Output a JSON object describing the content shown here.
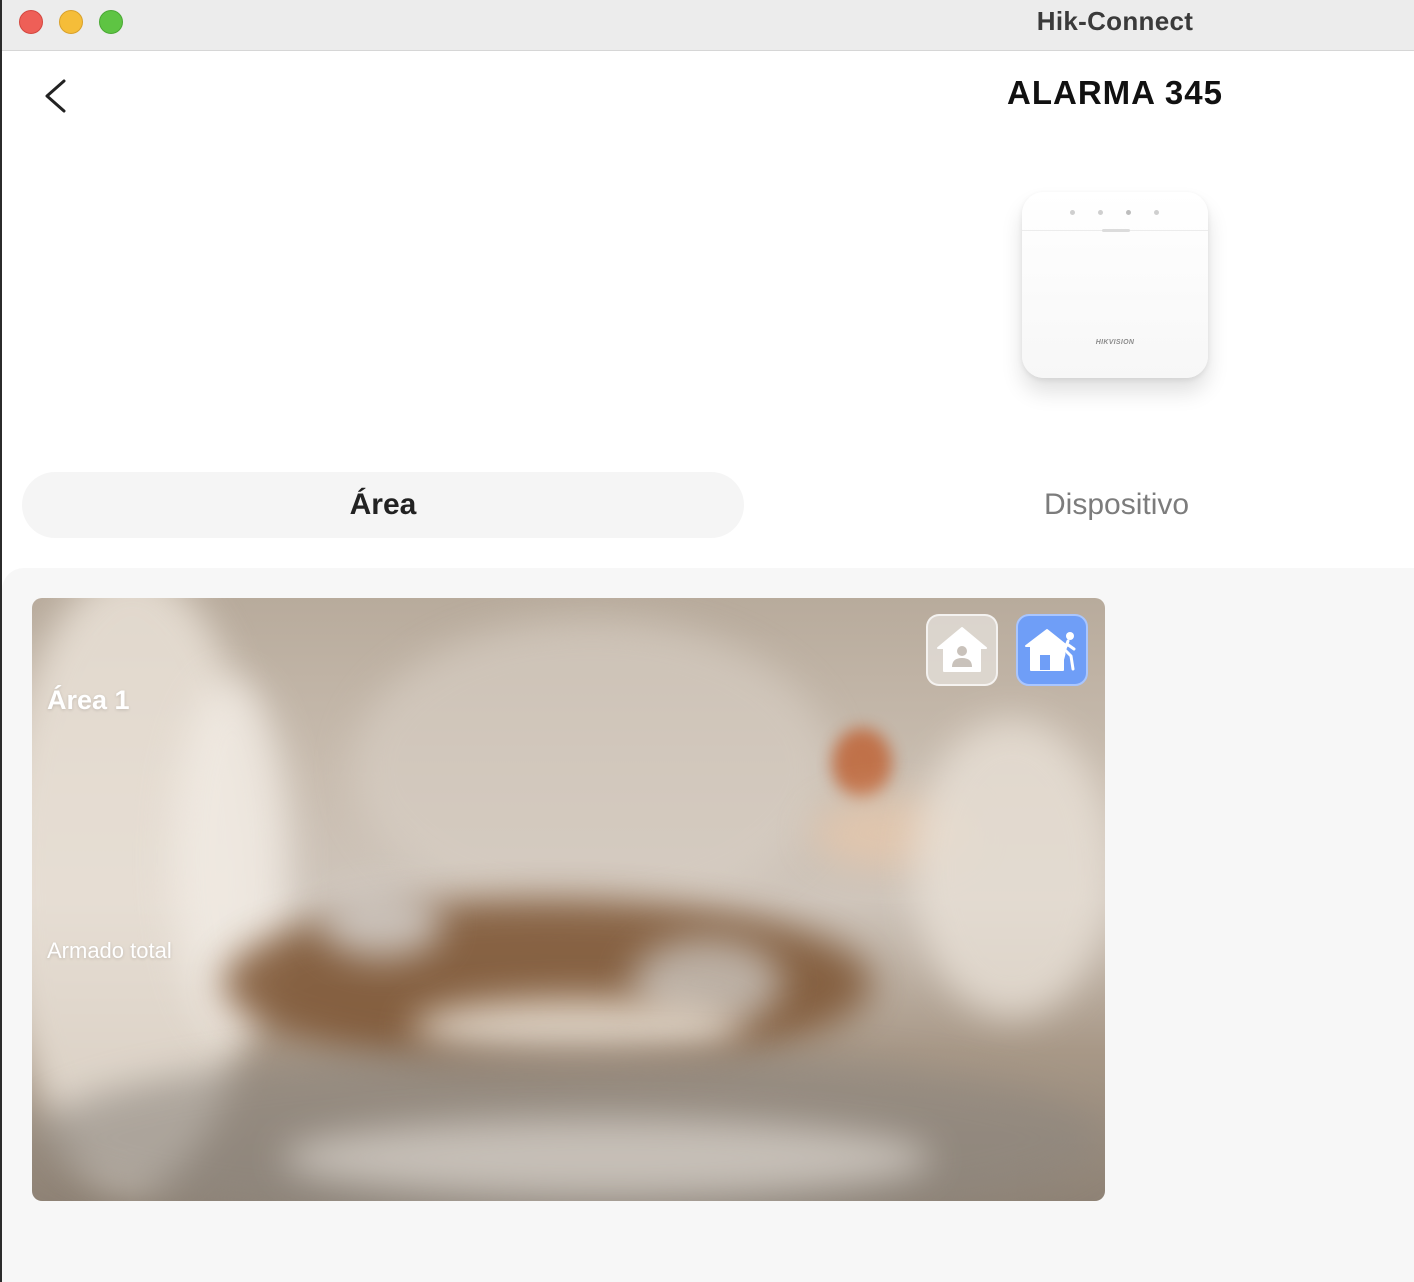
{
  "window": {
    "app_title": "Hik-Connect"
  },
  "header": {
    "title": "ALARMA 345",
    "back_icon": "chevron-left-icon"
  },
  "device": {
    "brand_text": "HIKVISION"
  },
  "tabs": [
    {
      "label": "Área",
      "selected": true
    },
    {
      "label": "Dispositivo",
      "selected": false
    }
  ],
  "areas": [
    {
      "name": "Área 1",
      "status": "Armado total",
      "mode_buttons": [
        {
          "icon": "home-stay-icon",
          "active": false
        },
        {
          "icon": "home-away-icon",
          "active": true
        }
      ]
    }
  ],
  "colors": {
    "accent": "#6f9ef7",
    "tab_selected_bg": "#f5f5f5",
    "content_bg": "#f7f7f7"
  }
}
